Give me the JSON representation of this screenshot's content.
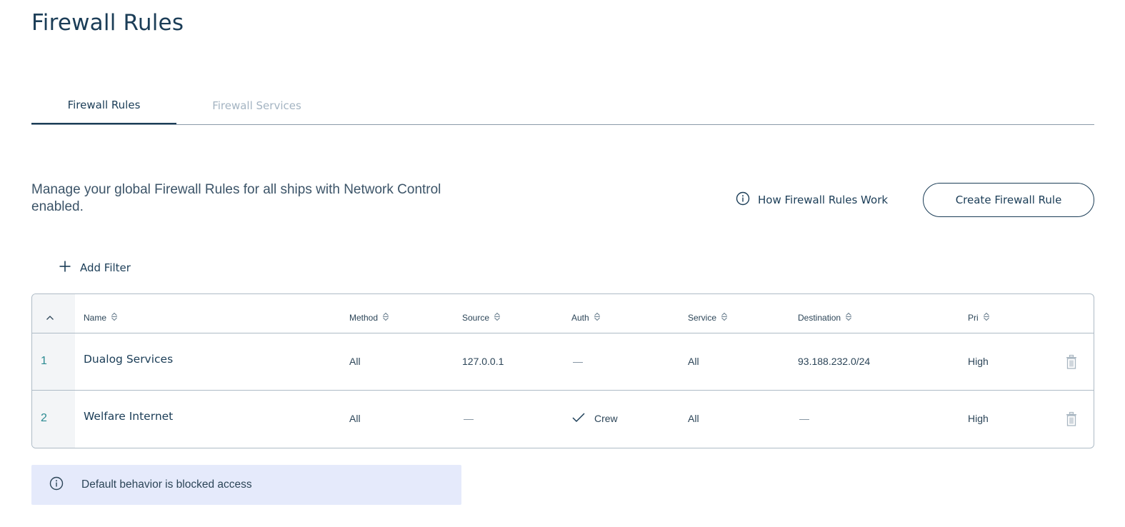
{
  "page": {
    "title": "Firewall Rules"
  },
  "tabs": [
    {
      "label": "Firewall Rules",
      "active": true
    },
    {
      "label": "Firewall Services",
      "active": false
    }
  ],
  "description": "Manage your global Firewall Rules for all ships with Network Control enabled.",
  "actions": {
    "how_link_label": "How Firewall Rules Work",
    "create_button_label": "Create Firewall Rule"
  },
  "filter": {
    "add_label": "Add Filter"
  },
  "table": {
    "columns": [
      "Name",
      "Method",
      "Source",
      "Auth",
      "Service",
      "Destination",
      "Pri"
    ],
    "rows": [
      {
        "index": "1",
        "name": "Dualog Services",
        "method": "All",
        "source": "127.0.0.1",
        "auth": "—",
        "auth_checked": false,
        "service": "All",
        "destination": "93.188.232.0/24",
        "priority": "High"
      },
      {
        "index": "2",
        "name": "Welfare Internet",
        "method": "All",
        "source": "—",
        "auth": "Crew",
        "auth_checked": true,
        "service": "All",
        "destination": "—",
        "priority": "High"
      }
    ]
  },
  "notice": {
    "text": "Default behavior is blocked access"
  },
  "icons": {
    "info": "info-circle-icon",
    "plus": "plus-icon",
    "sort": "sort-arrows-icon",
    "collapse": "chevron-up-icon",
    "check": "checkmark-icon",
    "delete": "trash-icon"
  },
  "colors": {
    "primary": "#1b3d57",
    "accent_index": "#2a8a91",
    "tab_inactive": "#a4b4c2",
    "notice_bg": "#e5eafb",
    "border": "#aebbc6"
  }
}
